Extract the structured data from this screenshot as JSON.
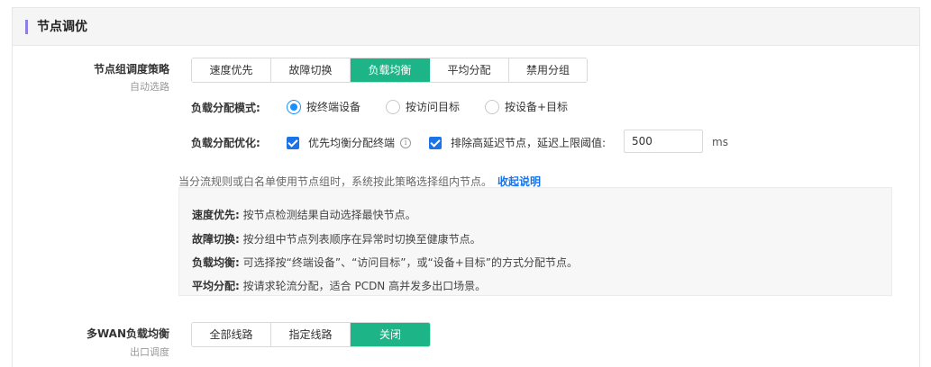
{
  "section": {
    "title": "节点调优"
  },
  "strategy": {
    "label": "节点组调度策略",
    "sublabel": "自动选路",
    "options": [
      "速度优先",
      "故障切换",
      "负载均衡",
      "平均分配",
      "禁用分组"
    ],
    "selected": "负载均衡"
  },
  "distribution_mode": {
    "label": "负载分配模式:",
    "options": [
      "按终端设备",
      "按访问目标",
      "按设备+目标"
    ],
    "selected": "按终端设备"
  },
  "optimization": {
    "label": "负载分配优化:",
    "prefer_balanced": {
      "label": "优先均衡分配终端",
      "checked": true
    },
    "exclude_high_latency": {
      "label": "排除高延迟节点，延迟上限阈值:",
      "checked": true
    },
    "threshold_value": "500",
    "threshold_unit": "ms"
  },
  "description": {
    "text": "当分流规则或白名单使用节点组时，系统按此策略选择组内节点。",
    "link": "收起说明"
  },
  "help": {
    "items": [
      {
        "term": "速度优先:",
        "desc": "按节点检测结果自动选择最快节点。"
      },
      {
        "term": "故障切换:",
        "desc": "按分组中节点列表顺序在异常时切换至健康节点。"
      },
      {
        "term": "负载均衡:",
        "desc": "可选择按“终端设备”、“访问目标”，或“设备+目标”的方式分配节点。"
      },
      {
        "term": "平均分配:",
        "desc": "按请求轮流分配，适合 PCDN 高并发多出口场景。"
      }
    ]
  },
  "multiwan": {
    "label": "多WAN负载均衡",
    "sublabel": "出口调度",
    "options": [
      "全部线路",
      "指定线路",
      "关闭"
    ],
    "selected": "关闭"
  },
  "colors": {
    "accent": "#1db587",
    "primary": "#1a73e8",
    "header_bar": "#8a80e6"
  }
}
